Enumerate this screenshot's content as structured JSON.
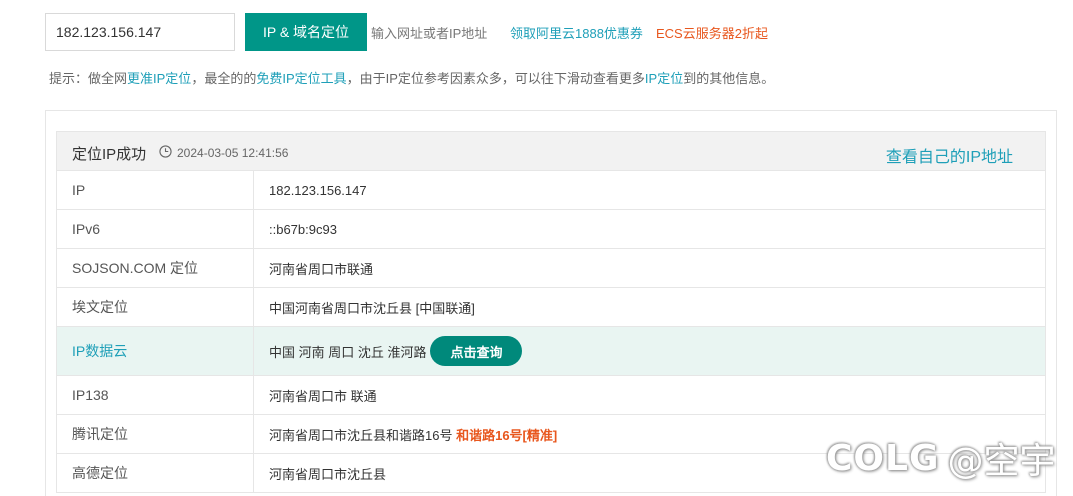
{
  "search": {
    "value": "182.123.156.147",
    "button_label": "IP & 域名定位",
    "hint": "输入网址或者IP地址",
    "promo_link": "领取阿里云1888优惠券",
    "ecs_link": "ECS云服务器2折起"
  },
  "tip": {
    "prefix": "提示：做全网",
    "link1": "更准IP定位",
    "mid1": "，最全的的",
    "link2": "免费IP定位工具",
    "mid2": "，由于IP定位参考因素众多，可以往下滑动查看更多",
    "link3": "IP定位",
    "suffix": "到的其他信息。"
  },
  "result": {
    "title": "定位IP成功",
    "time": "2024-03-05 12:41:56",
    "self_ip_link": "查看自己的IP地址",
    "rows": [
      {
        "label": "IP",
        "value": "182.123.156.147"
      },
      {
        "label": "IPv6",
        "value": "::b67b:9c93"
      },
      {
        "label": "SOJSON.COM 定位",
        "value": "河南省周口市联通"
      },
      {
        "label": "埃文定位",
        "value": "中国河南省周口市沈丘县 [中国联通]"
      },
      {
        "label": "IP数据云",
        "value": "中国 河南 周口 沈丘 淮河路",
        "button": "点击查询"
      },
      {
        "label": "IP138",
        "value": "河南省周口市 联通"
      },
      {
        "label": "腾讯定位",
        "value": "河南省周口市沈丘县和谐路16号",
        "accent": "和谐路16号[精准]"
      },
      {
        "label": "高德定位",
        "value": "河南省周口市沈丘县"
      }
    ]
  },
  "watermark": {
    "logo": "COLG",
    "text": "@空宇"
  },
  "colors": {
    "primary": "#009688",
    "link": "#1e9fb8",
    "accent": "#e8571e",
    "highlight_row": "#e9f5f2"
  }
}
